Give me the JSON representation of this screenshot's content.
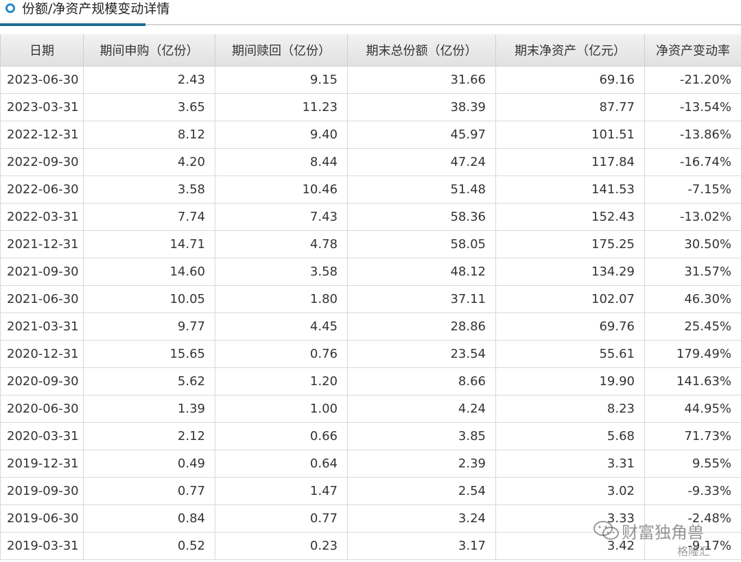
{
  "section": {
    "title": "份额/净资产规模变动详情",
    "icon": "circle-bullet-icon",
    "accent_color": "#1e6d96"
  },
  "table": {
    "headers": [
      "日期",
      "期间申购（亿份）",
      "期间赎回（亿份）",
      "期末总份额（亿份）",
      "期末净资产（亿元）",
      "净资产变动率"
    ],
    "rows": [
      [
        "2023-06-30",
        "2.43",
        "9.15",
        "31.66",
        "69.16",
        "-21.20%"
      ],
      [
        "2023-03-31",
        "3.65",
        "11.23",
        "38.39",
        "87.77",
        "-13.54%"
      ],
      [
        "2022-12-31",
        "8.12",
        "9.40",
        "45.97",
        "101.51",
        "-13.86%"
      ],
      [
        "2022-09-30",
        "4.20",
        "8.44",
        "47.24",
        "117.84",
        "-16.74%"
      ],
      [
        "2022-06-30",
        "3.58",
        "10.46",
        "51.48",
        "141.53",
        "-7.15%"
      ],
      [
        "2022-03-31",
        "7.74",
        "7.43",
        "58.36",
        "152.43",
        "-13.02%"
      ],
      [
        "2021-12-31",
        "14.71",
        "4.78",
        "58.05",
        "175.25",
        "30.50%"
      ],
      [
        "2021-09-30",
        "14.60",
        "3.58",
        "48.12",
        "134.29",
        "31.57%"
      ],
      [
        "2021-06-30",
        "10.05",
        "1.80",
        "37.11",
        "102.07",
        "46.30%"
      ],
      [
        "2021-03-31",
        "9.77",
        "4.45",
        "28.86",
        "69.76",
        "25.45%"
      ],
      [
        "2020-12-31",
        "15.65",
        "0.76",
        "23.54",
        "55.61",
        "179.49%"
      ],
      [
        "2020-09-30",
        "5.62",
        "1.20",
        "8.66",
        "19.90",
        "141.63%"
      ],
      [
        "2020-06-30",
        "1.39",
        "1.00",
        "4.24",
        "8.23",
        "44.95%"
      ],
      [
        "2020-03-31",
        "2.12",
        "0.66",
        "3.85",
        "5.68",
        "71.73%"
      ],
      [
        "2019-12-31",
        "0.49",
        "0.64",
        "2.39",
        "3.31",
        "9.55%"
      ],
      [
        "2019-09-30",
        "0.77",
        "1.47",
        "2.54",
        "3.02",
        "-9.33%"
      ],
      [
        "2019-06-30",
        "0.84",
        "0.77",
        "3.24",
        "3.33",
        "-2.48%"
      ],
      [
        "2019-03-31",
        "0.52",
        "0.23",
        "3.17",
        "3.42",
        "-9.17%"
      ]
    ]
  },
  "watermark": {
    "name": "财富独角兽",
    "logo_text": "格隆汇",
    "icon": "wechat-icon"
  }
}
